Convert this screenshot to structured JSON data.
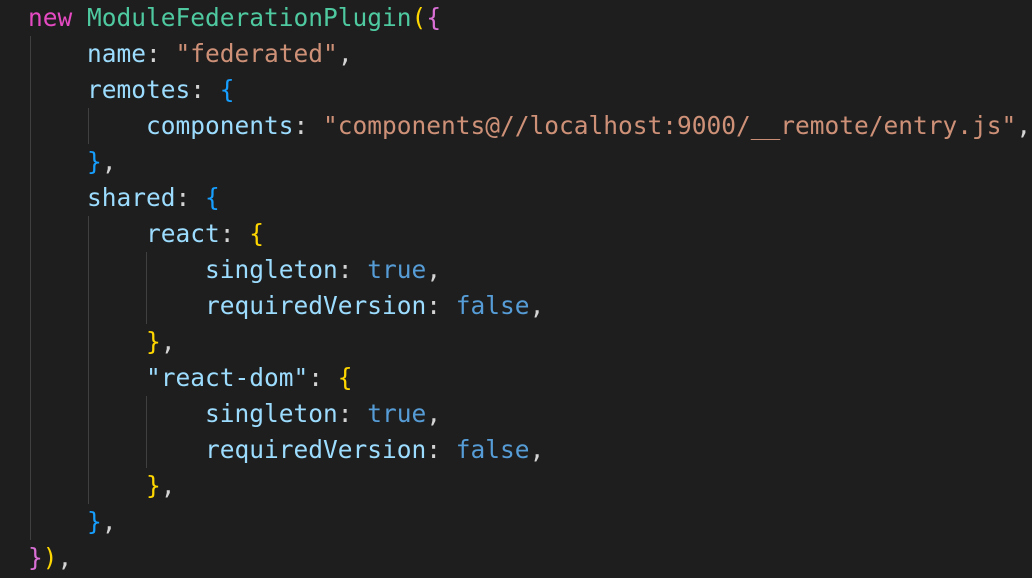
{
  "colors": {
    "background": "#1e1e1e",
    "keyword": "#e54ac2",
    "class_name": "#4ec9a0",
    "property": "#9cdcfe",
    "string": "#ce9178",
    "boolean": "#569cd6",
    "bracket_level1": "#ffd700",
    "bracket_level2": "#da70d6",
    "bracket_level3": "#179fff"
  },
  "code": {
    "lines": [
      {
        "tokens": [
          "new",
          " ",
          "ModuleFederationPlugin",
          "(",
          "{"
        ]
      },
      {
        "tokens": [
          "    ",
          "name",
          ": ",
          "\"federated\"",
          ","
        ]
      },
      {
        "tokens": [
          "    ",
          "remotes",
          ": ",
          "{"
        ]
      },
      {
        "tokens": [
          "        ",
          "components",
          ": ",
          "\"components@//localhost:9000/__remote/entry.js\"",
          ","
        ]
      },
      {
        "tokens": [
          "    ",
          "}",
          ","
        ]
      },
      {
        "tokens": [
          "    ",
          "shared",
          ": ",
          "{"
        ]
      },
      {
        "tokens": [
          "        ",
          "react",
          ": ",
          "{"
        ]
      },
      {
        "tokens": [
          "            ",
          "singleton",
          ": ",
          "true",
          ","
        ]
      },
      {
        "tokens": [
          "            ",
          "requiredVersion",
          ": ",
          "false",
          ","
        ]
      },
      {
        "tokens": [
          "        ",
          "}",
          ","
        ]
      },
      {
        "tokens": [
          "        ",
          "\"react-dom\"",
          ": ",
          "{"
        ]
      },
      {
        "tokens": [
          "            ",
          "singleton",
          ": ",
          "true",
          ","
        ]
      },
      {
        "tokens": [
          "            ",
          "requiredVersion",
          ": ",
          "false",
          ","
        ]
      },
      {
        "tokens": [
          "        ",
          "}",
          ","
        ]
      },
      {
        "tokens": [
          "    ",
          "}",
          ","
        ]
      },
      {
        "tokens": [
          "}",
          ")",
          ","
        ]
      }
    ]
  }
}
